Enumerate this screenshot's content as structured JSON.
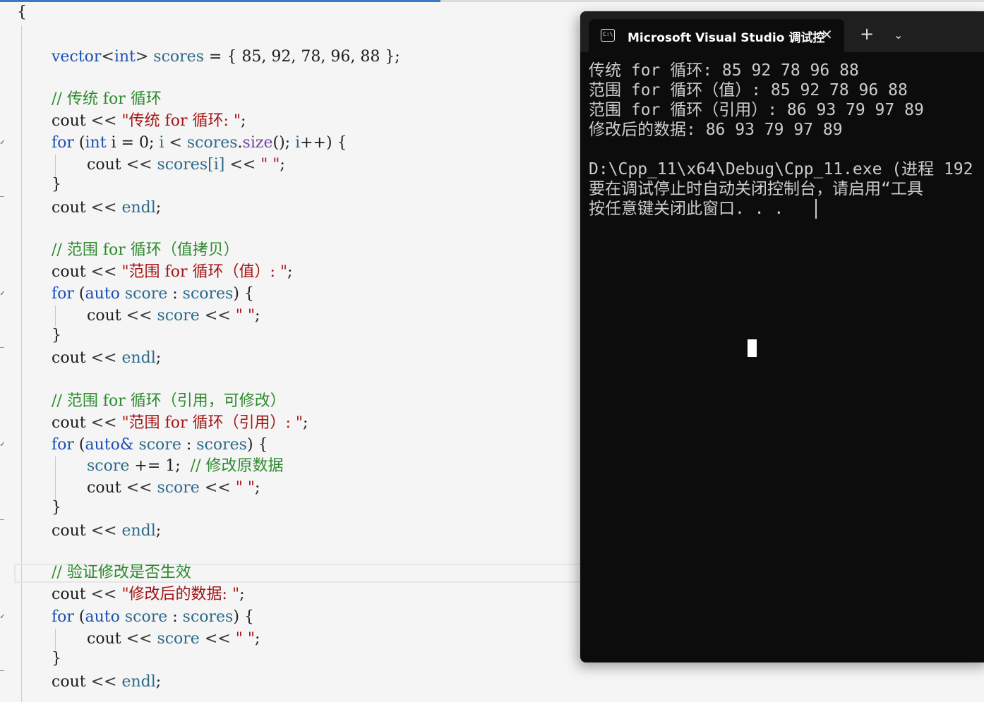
{
  "editor": {
    "lines": {
      "brace_open": "{",
      "l_vec_a": "vector",
      "l_vec_b": "<",
      "l_vec_c": "int",
      "l_vec_d": "> ",
      "l_vec_e": "scores",
      "l_vec_f": " = { 85, 92, 78, 96, 88 };",
      "c1": "// 传统 for 循环",
      "l3_a": "cout",
      "l3_b": " << ",
      "l3_c": "\"传统 for 循环: \"",
      "l3_d": ";",
      "l4_a": "for",
      "l4_b": " (",
      "l4_c": "int",
      "l4_d": " i = 0; ",
      "l4_e": "i",
      "l4_f": " < ",
      "l4_g": "scores",
      "l4_h": ".",
      "l4_i": "size",
      "l4_j": "(); ",
      "l4_k": "i",
      "l4_l": "++) {",
      "l5_a": "cout",
      "l5_b": " << ",
      "l5_c": "scores",
      "l5_d": "[i]",
      "l5_e": " << ",
      "l5_f": "\" \"",
      "l5_g": ";",
      "close": "}",
      "endl_a": "cout",
      "endl_b": " << ",
      "endl_c": "endl",
      "endl_d": ";",
      "c2": "// 范围 for 循环（值拷贝）",
      "l8_c": "\"范围 for 循环（值）: \"",
      "l9_c": "auto",
      "l9_d": " score",
      "l9_e": " : ",
      "l9_f": "scores",
      "l9_g": ") {",
      "l10_c": "score",
      "c3": "// 范围 for 循环（引用，可修改）",
      "l13_c": "\"范围 for 循环（引用）: \"",
      "l14_c": "auto&",
      "l15_a": "score",
      "l15_b": " += 1;  ",
      "l15_c": "// 修改原数据",
      "c4": "// 验证修改是否生效",
      "l19_c": "\"修改后的数据: \""
    }
  },
  "console": {
    "title": "Microsoft Visual Studio 调试控",
    "icon": "terminal-icon",
    "close_glyph": "✕",
    "new_tab_glyph": "+",
    "dropdown_glyph": "⌄",
    "output": [
      "传统 for 循环: 85 92 78 96 88",
      "范围 for 循环（值）: 85 92 78 96 88",
      "范围 for 循环（引用）: 86 93 79 97 89",
      "修改后的数据: 86 93 79 97 89",
      "",
      "D:\\Cpp_11\\x64\\Debug\\Cpp_11.exe (进程 192",
      "要在调试停止时自动关闭控制台，请启用“工具",
      "按任意键关闭此窗口. . ."
    ]
  },
  "colors": {
    "keyword": "#1a4fb8",
    "string": "#a31515",
    "comment": "#2d8a2d",
    "variable": "#2b6a8a",
    "console_bg": "#0c0c0c",
    "console_titlebar": "#1f1f1f"
  }
}
